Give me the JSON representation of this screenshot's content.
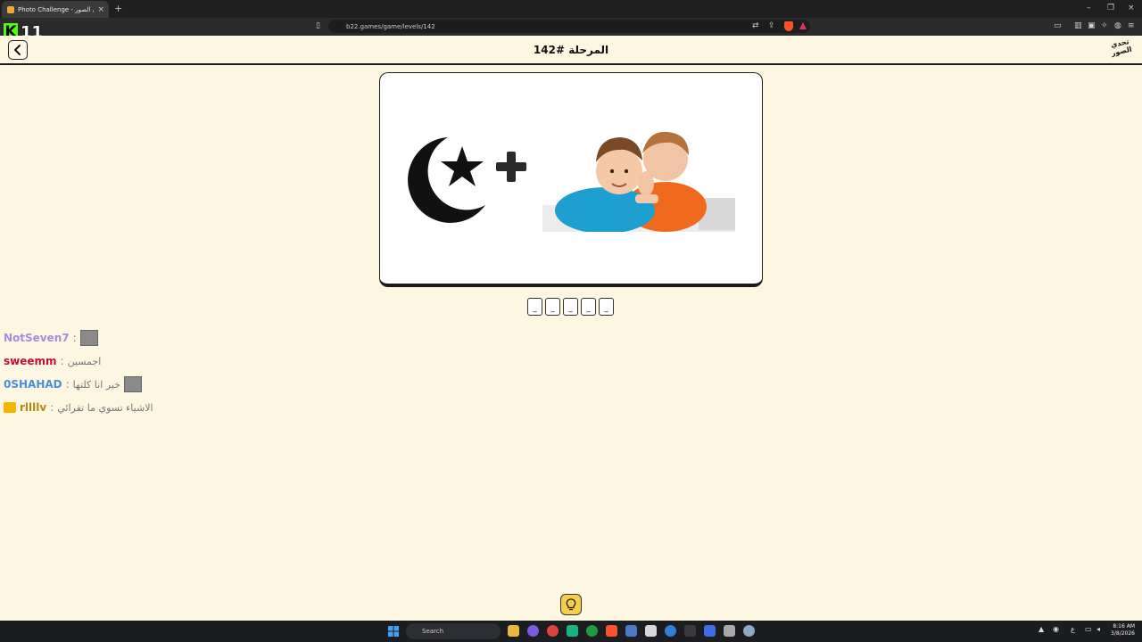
{
  "browser": {
    "tab_title": "Photo Challenge - تحدي الصور",
    "tab_close": "×",
    "new_tab": "+",
    "url": "b22.games/game/levels/142",
    "window_controls": [
      "–",
      "❐",
      "×"
    ]
  },
  "stream_overlay": {
    "platform_logo_letter": "K",
    "viewer_count": "11"
  },
  "game": {
    "level_title": "المرحلة #142",
    "site_logo_text": "تحدي الصور",
    "puzzle": {
      "left_image": "crescent-and-star-icon",
      "operator": "+",
      "right_image": "two-boys-whispering-photo"
    },
    "answer_slots": [
      "_",
      "_",
      "_",
      "_",
      "_"
    ],
    "hint_icon": "lightbulb-icon"
  },
  "chat": [
    {
      "user": "NotSeven7",
      "color": "#a98bd9",
      "sep": ":",
      "message": "",
      "emote": true,
      "badge": false
    },
    {
      "user": "sweemm",
      "color": "#c0102d",
      "sep": ":",
      "message": "اجمسين",
      "emote": false,
      "badge": false
    },
    {
      "user": "0SHAHAD",
      "color": "#4a8fd6",
      "sep": ":",
      "message": "خير انا كلتها",
      "emote": true,
      "badge": false
    },
    {
      "user": "rllllv",
      "color": "#b8860b",
      "sep": ":",
      "message": "الاشياء تسوي ما تقرائي",
      "emote": false,
      "badge": true
    }
  ],
  "taskbar": {
    "search_label": "Search",
    "clock_time": "8:16 AM",
    "clock_date": "3/8/2026",
    "lang": "ع"
  },
  "colors": {
    "page_background": "#fdf6e1",
    "hint_button": "#f7ce4a",
    "kick_green": "#53fc18"
  }
}
